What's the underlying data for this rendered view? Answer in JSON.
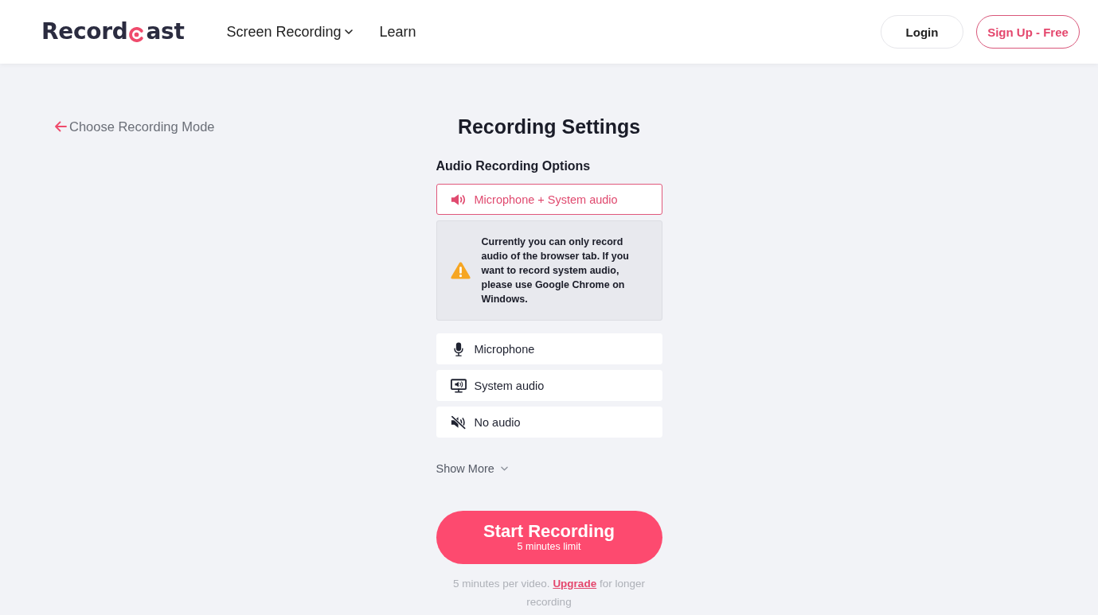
{
  "header": {
    "logo": {
      "text_before": "Record",
      "text_after": "ast"
    },
    "nav": [
      {
        "label": "Screen Recording",
        "has_menu": true
      },
      {
        "label": "Learn",
        "has_menu": false
      }
    ],
    "buttons": [
      {
        "label": "Login",
        "kind": "plain"
      },
      {
        "label": "Sign Up - Free",
        "kind": "accent"
      }
    ]
  },
  "back_link": {
    "label": "Choose Recording Mode"
  },
  "title": "Recording Settings",
  "audio": {
    "heading": "Audio Recording Options",
    "options": [
      {
        "label": "Microphone + System audio",
        "kind": "mic_and_system",
        "selected": true,
        "notice": "Currently you can only record audio of the browser tab. If you want to record system audio, please use Google Chrome on Windows."
      },
      {
        "label": "Microphone",
        "kind": "microphone",
        "selected": false
      },
      {
        "label": "System audio",
        "kind": "system",
        "selected": false
      },
      {
        "label": "No audio",
        "kind": "none",
        "selected": false
      }
    ]
  },
  "show_more": {
    "label": "Show More",
    "expanded": false
  },
  "start_button": {
    "label": "Start Recording",
    "sublabel": "5 minutes limit"
  },
  "limit_note": {
    "text_before": "5 minutes per video.",
    "link": "Upgrade",
    "text_after": "for longer recording"
  }
}
